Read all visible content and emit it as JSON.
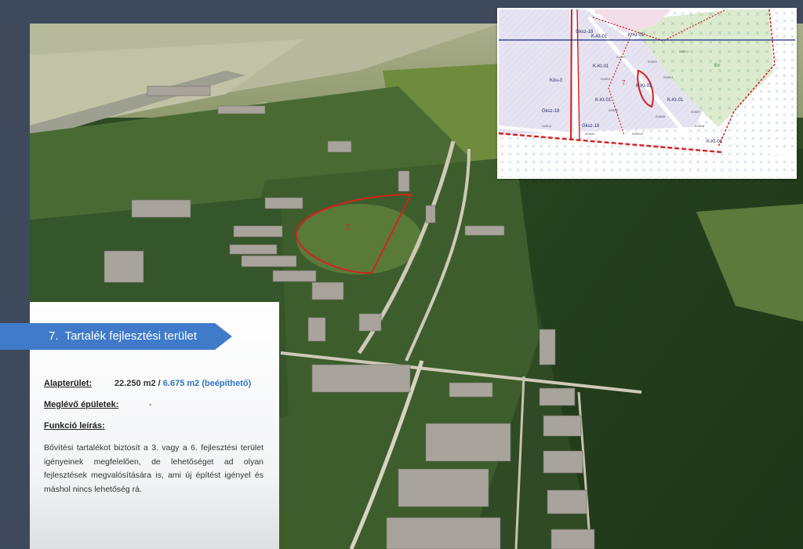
{
  "map_inset": {
    "zone_labels": [
      "Gksz-18",
      "K-Kt-01",
      "K-Kt-01",
      "K-Kt-01",
      "K-Kt-01",
      "Gksz-18",
      "Gksz-18",
      "K-Kt-01",
      "K-Kt-01",
      "K-Kt-01",
      "Ev",
      "Köu-3"
    ],
    "area_number": "7.",
    "parcel_numbers": [
      "0280/1",
      "0280/2",
      "0280/3",
      "0280/4",
      "0280/5",
      "0280/6",
      "0280/7",
      "0280/8",
      "0280/9",
      "0280/10",
      "0281/1",
      "0281/2"
    ]
  },
  "aerial": {
    "area_marker": "7."
  },
  "section": {
    "number": "7.",
    "title": "Tartalék fejlesztési terület"
  },
  "details": {
    "area_label": "Alapterület:",
    "area_total": "22.250 m2 /",
    "area_buildable": "6.675 m2 (beépíthető)",
    "buildings_label": "Meglévő épületek:",
    "buildings_value": "-",
    "function_label": "Funkció leírás:",
    "function_text": "Bővítési tartalékot biztosít a 3. vagy a 6. fejlesztési terület igényeinek megfelelően, de lehetőséget ad olyan fejlesztések megvalósítására is, ami új építést igényel és máshol nincs lehetőség rá."
  },
  "colors": {
    "frame": "#3e4a5c",
    "banner": "#3f7bc9",
    "buildable_accent": "#2e78c7",
    "boundary_red": "#d62020"
  }
}
